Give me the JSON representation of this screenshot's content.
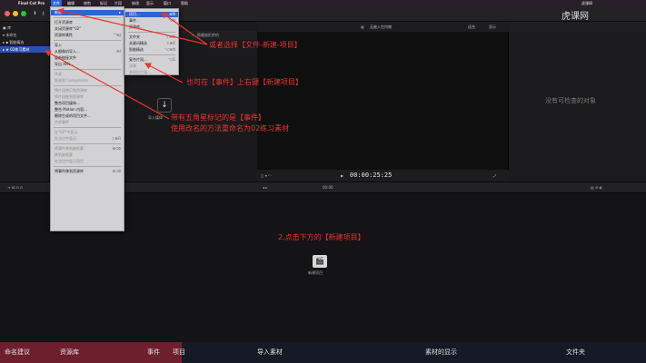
{
  "menubar": {
    "apple": "",
    "app": "Final Cut Pro",
    "items": [
      "文件",
      "编辑",
      "修剪",
      "标记",
      "片段",
      "修改",
      "显示",
      "窗口",
      "帮助"
    ],
    "right_text": "虎课网"
  },
  "toolbar": {
    "watermark": "虎课网"
  },
  "library": {
    "rows": [
      {
        "label": "库"
      },
      {
        "label": "未命名"
      },
      {
        "label": "智能精选"
      },
      {
        "label": "02练习素材"
      }
    ]
  },
  "browser": {
    "filter_label": "隐藏被拒绝的",
    "search_placeholder": "搜索",
    "import_label": "导入媒体"
  },
  "viewer": {
    "title": "无被入住何物",
    "zoom": "适合",
    "view": "显示",
    "timecode": "00:00:25:25"
  },
  "inspector": {
    "empty_text": "没有可检查的对象"
  },
  "midbar": {
    "timecode": "00:00"
  },
  "timeline": {
    "new_project_label": "新建项目"
  },
  "file_menu": {
    "items": [
      {
        "label": "新建",
        "shortcut": "",
        "hl": true
      },
      {
        "label": "打开资源库",
        "shortcut": ""
      },
      {
        "label": "关闭资源库“02”",
        "shortcut": ""
      },
      {
        "label": "资源库属性",
        "shortcut": "^⌘J"
      },
      {
        "label": "导入",
        "shortcut": ""
      },
      {
        "label": "从摄像机导入...",
        "shortcut": "⌘I"
      },
      {
        "label": "重新链接文件",
        "shortcut": ""
      },
      {
        "label": "导出 XML...",
        "shortcut": ""
      },
      {
        "label": "共享",
        "shortcut": ""
      },
      {
        "label": "发送到 Compressor",
        "shortcut": ""
      },
      {
        "label": "将片段拷贝到资源库",
        "shortcut": ""
      },
      {
        "label": "将片段移到资源库",
        "shortcut": ""
      },
      {
        "label": "整合项目媒体...",
        "shortcut": ""
      },
      {
        "label": "整合 Motion 内容...",
        "shortcut": ""
      },
      {
        "label": "删除生成的项目文件...",
        "shortcut": ""
      },
      {
        "label": "合并事件",
        "shortcut": ""
      },
      {
        "label": "在“02”中显示",
        "shortcut": ""
      },
      {
        "label": "在访达中显示",
        "shortcut": "⇧⌘R"
      },
      {
        "label": "将事件移到废纸篓",
        "shortcut": "⌘⌫"
      },
      {
        "label": "移到废纸篓",
        "shortcut": ""
      },
      {
        "label": "在访达中显示项目",
        "shortcut": ""
      },
      {
        "label": "将事件移到资源库",
        "shortcut": "⌘⌫"
      }
    ]
  },
  "new_submenu": {
    "items": [
      {
        "label": "项目...",
        "shortcut": "⌘N",
        "hl": true
      },
      {
        "label": "事件...",
        "shortcut": "⌥N"
      },
      {
        "label": "资源库...",
        "shortcut": ""
      },
      {
        "label": "文件夹",
        "shortcut": "⇧⌘N"
      },
      {
        "label": "关键词精选",
        "shortcut": "⇧⌘K"
      },
      {
        "label": "智能精选",
        "shortcut": "⌥⌘N"
      },
      {
        "label": "复合片段...",
        "shortcut": "⌥G"
      },
      {
        "label": "试演",
        "shortcut": ""
      },
      {
        "label": "多机位片段...",
        "shortcut": ""
      }
    ]
  },
  "annotations": {
    "a1": "或者选择【文件-新建-项目】",
    "a2": "也可在【事件】上右键【新建项目】",
    "a3_line1": "带有五角星标记的是【事件】",
    "a3_line2": "使用改名的方法重命名为02练习素材",
    "a4": "2.点击下方的【新建项目】"
  },
  "bottombar": {
    "items": [
      "命名建议",
      "资源库",
      "事件",
      "项目",
      "导入素材",
      "素材的显示",
      "文件夹"
    ]
  },
  "colors": {
    "annotation": "#e8342c",
    "highlight": "#2f63d1"
  }
}
